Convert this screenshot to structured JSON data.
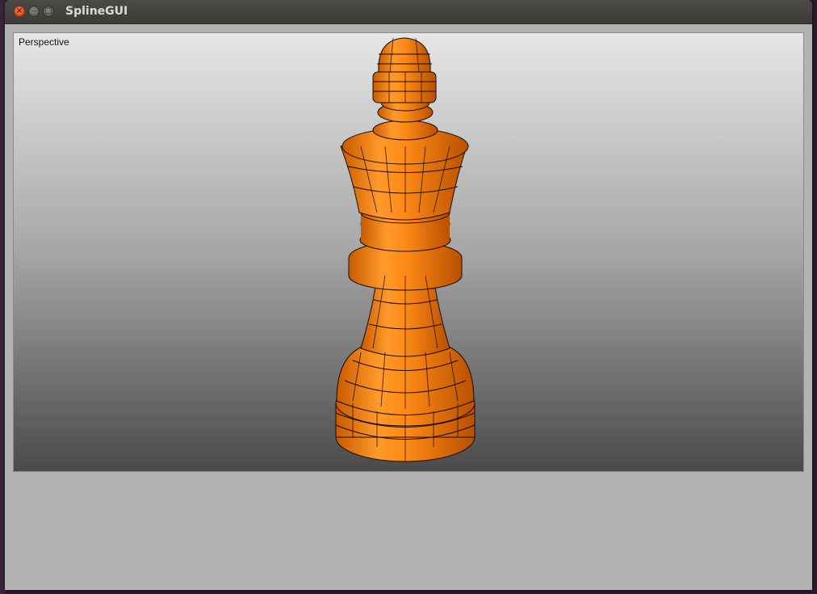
{
  "window": {
    "title": "SplineGUI",
    "close_glyph": "×",
    "minimize_glyph": "–",
    "maximize_glyph": "□"
  },
  "viewport": {
    "label": "Perspective"
  },
  "model": {
    "object": "chess-king",
    "color": "#ff8a16",
    "wire_color": "#1a0a00"
  }
}
